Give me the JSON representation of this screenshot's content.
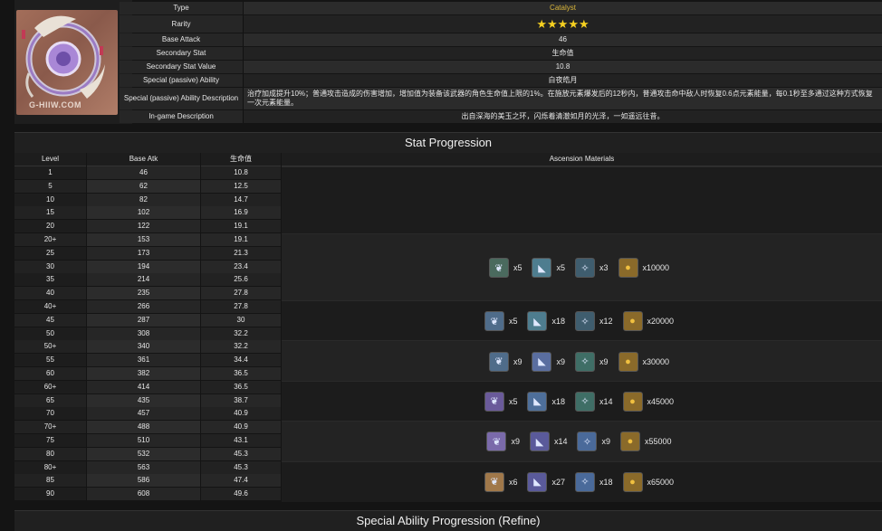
{
  "weapon": {
    "watermark": "G-HIIW.COM",
    "rows": [
      {
        "label": "Type",
        "value": "Catalyst"
      },
      {
        "label": "Rarity",
        "value": "★★★★★"
      },
      {
        "label": "Base Attack",
        "value": "46"
      },
      {
        "label": "Secondary Stat",
        "value": "生命值"
      },
      {
        "label": "Secondary Stat Value",
        "value": "10.8"
      },
      {
        "label": "Special (passive) Ability",
        "value": "白夜皓月"
      },
      {
        "label": "Special (passive) Ability Description",
        "value": "治疗加成提升10%；普通攻击造成的伤害增加，增加值为装备该武器的角色生命值上限的1%。在施放元素爆发后的12秒内，普通攻击命中敌人时恢复0.6点元素能量，每0.1秒至多通过这种方式恢复一次元素能量。"
      },
      {
        "label": "In-game Description",
        "value": "出自深海的美玉之环，闪烁着清澈如月的光泽，一如遥远往昔。"
      }
    ]
  },
  "progression": {
    "title": "Stat Progression",
    "headers": [
      "Level",
      "Base Atk",
      "生命值",
      "Ascension Materials"
    ],
    "rows": [
      [
        "1",
        "46",
        "10.8"
      ],
      [
        "5",
        "62",
        "12.5"
      ],
      [
        "10",
        "82",
        "14.7"
      ],
      [
        "15",
        "102",
        "16.9"
      ],
      [
        "20",
        "122",
        "19.1"
      ],
      [
        "20+",
        "153",
        "19.1"
      ],
      [
        "25",
        "173",
        "21.3"
      ],
      [
        "30",
        "194",
        "23.4"
      ],
      [
        "35",
        "214",
        "25.6"
      ],
      [
        "40",
        "235",
        "27.8"
      ],
      [
        "40+",
        "266",
        "27.8"
      ],
      [
        "45",
        "287",
        "30"
      ],
      [
        "50",
        "308",
        "32.2"
      ],
      [
        "50+",
        "340",
        "32.2"
      ],
      [
        "55",
        "361",
        "34.4"
      ],
      [
        "60",
        "382",
        "36.5"
      ],
      [
        "60+",
        "414",
        "36.5"
      ],
      [
        "65",
        "435",
        "38.7"
      ],
      [
        "70",
        "457",
        "40.9"
      ],
      [
        "70+",
        "488",
        "40.9"
      ],
      [
        "75",
        "510",
        "43.1"
      ],
      [
        "80",
        "532",
        "45.3"
      ],
      [
        "80+",
        "563",
        "45.3"
      ],
      [
        "85",
        "586",
        "47.4"
      ],
      [
        "90",
        "608",
        "49.6"
      ]
    ],
    "materials": [
      {
        "items": [
          {
            "icon": "branch-material-icon",
            "q": "x5",
            "color": "#4a6a5e"
          },
          {
            "icon": "arrowhead-material-icon",
            "q": "x5",
            "color": "#4e7d8f"
          },
          {
            "icon": "nectar-material-icon",
            "q": "x3",
            "color": "#3f5d6e"
          },
          {
            "icon": "mora-coin-icon",
            "q": "x10000",
            "color": "#8a6a2a"
          }
        ]
      },
      {
        "items": [
          {
            "icon": "branch-material-icon",
            "q": "x5",
            "color": "#4f6c8a"
          },
          {
            "icon": "arrowhead-material-icon",
            "q": "x18",
            "color": "#4e7d8f"
          },
          {
            "icon": "nectar-material-icon",
            "q": "x12",
            "color": "#3f5d6e"
          },
          {
            "icon": "mora-coin-icon",
            "q": "x20000",
            "color": "#8a6a2a"
          }
        ]
      },
      {
        "items": [
          {
            "icon": "branch-material-icon",
            "q": "x9",
            "color": "#4f6c8a"
          },
          {
            "icon": "arrowhead-material-icon",
            "q": "x9",
            "color": "#5a6ea0"
          },
          {
            "icon": "nectar-material-icon",
            "q": "x9",
            "color": "#3f6e66"
          },
          {
            "icon": "mora-coin-icon",
            "q": "x30000",
            "color": "#8a6a2a"
          }
        ]
      },
      {
        "items": [
          {
            "icon": "branch-material-icon",
            "q": "x5",
            "color": "#6a5a9a"
          },
          {
            "icon": "arrowhead-material-icon",
            "q": "x18",
            "color": "#4e6f9a"
          },
          {
            "icon": "nectar-material-icon",
            "q": "x14",
            "color": "#3f6e66"
          },
          {
            "icon": "mora-coin-icon",
            "q": "x45000",
            "color": "#8a6a2a"
          }
        ]
      },
      {
        "items": [
          {
            "icon": "branch-material-icon",
            "q": "x9",
            "color": "#7a6aaa"
          },
          {
            "icon": "arrowhead-material-icon",
            "q": "x14",
            "color": "#5a5a9a"
          },
          {
            "icon": "nectar-material-icon",
            "q": "x9",
            "color": "#4a6a9a"
          },
          {
            "icon": "mora-coin-icon",
            "q": "x55000",
            "color": "#8a6a2a"
          }
        ]
      },
      {
        "items": [
          {
            "icon": "branch-material-icon",
            "q": "x6",
            "color": "#a0784a"
          },
          {
            "icon": "arrowhead-material-icon",
            "q": "x27",
            "color": "#5a5a9a"
          },
          {
            "icon": "nectar-material-icon",
            "q": "x18",
            "color": "#4a6a9a"
          },
          {
            "icon": "mora-coin-icon",
            "q": "x65000",
            "color": "#8a6a2a"
          }
        ]
      }
    ]
  },
  "refine": {
    "title": "Special Ability Progression (Refine)"
  }
}
